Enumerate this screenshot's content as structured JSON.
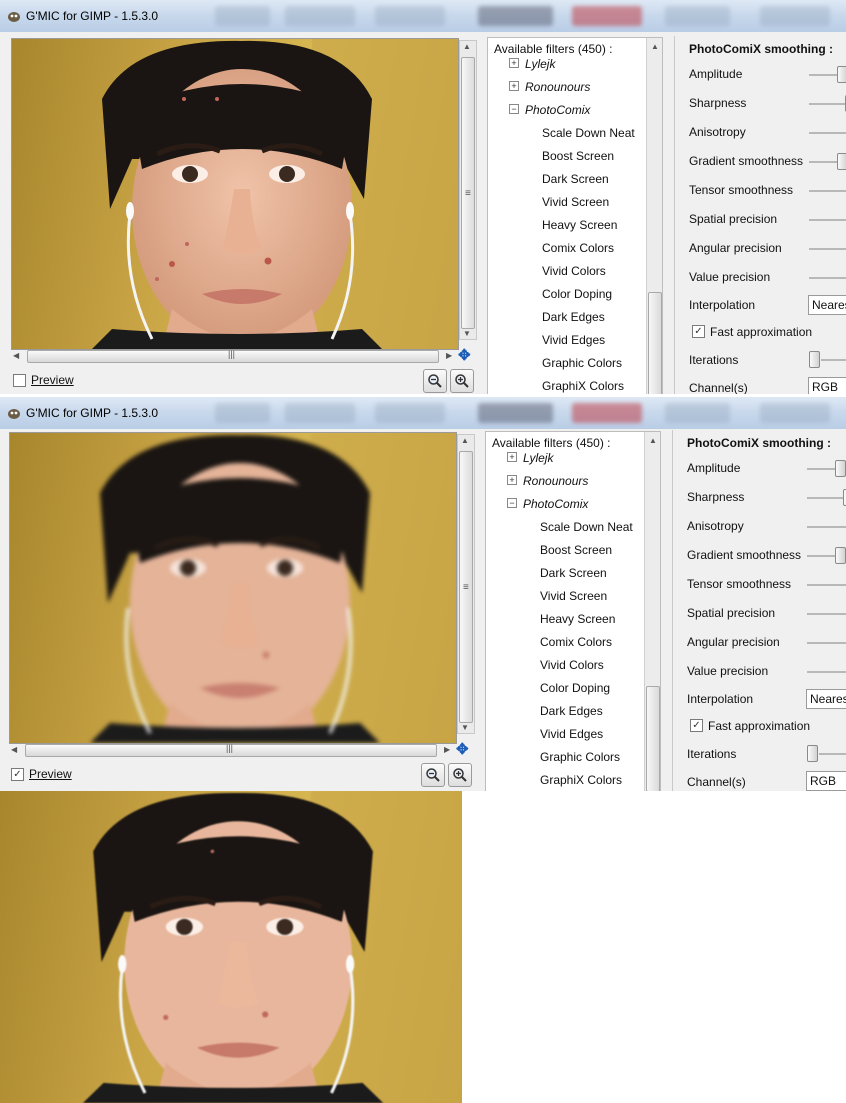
{
  "windows": [
    {
      "id": "before",
      "title": "G'MIC for GIMP - 1.5.3.0",
      "preview_label": "Preview",
      "preview_checked": false,
      "filters": {
        "header": "Available filters (450) :",
        "categories": [
          "Lylejk",
          "Ronounours",
          "PhotoComix"
        ],
        "items": [
          "Scale Down Neat",
          "Boost Screen",
          "Dark Screen",
          "Vivid Screen",
          "Heavy Screen",
          "Comix Colors",
          "Vivid Colors",
          "Color Doping",
          "Dark Edges",
          "Vivid Edges",
          "Graphic Colors",
          "GraphiX Colors"
        ]
      },
      "params": {
        "title": "PhotoComiX smoothing :",
        "labels": [
          "Amplitude",
          "Sharpness",
          "Anisotropy",
          "Gradient smoothness",
          "Tensor smoothness",
          "Spatial precision",
          "Angular precision",
          "Value precision",
          "Interpolation",
          "Fast approximation",
          "Iterations",
          "Channel(s)"
        ],
        "interpolation_value": "Nearest",
        "channel_value": "RGB",
        "fast_approximation_checked": true
      }
    },
    {
      "id": "after",
      "title": "G'MIC for GIMP - 1.5.3.0",
      "preview_label": "Preview",
      "preview_checked": true,
      "filters": {
        "header": "Available filters (450) :",
        "categories": [
          "Lylejk",
          "Ronounours",
          "PhotoComix"
        ],
        "items": [
          "Scale Down Neat",
          "Boost Screen",
          "Dark Screen",
          "Vivid Screen",
          "Heavy Screen",
          "Comix Colors",
          "Vivid Colors",
          "Color Doping",
          "Dark Edges",
          "Vivid Edges",
          "Graphic Colors",
          "GraphiX Colors"
        ]
      },
      "params": {
        "title": "PhotoComiX smoothing :",
        "labels": [
          "Amplitude",
          "Sharpness",
          "Anisotropy",
          "Gradient smoothness",
          "Tensor smoothness",
          "Spatial precision",
          "Angular precision",
          "Value precision",
          "Interpolation",
          "Fast approximation",
          "Iterations",
          "Channel(s)"
        ],
        "interpolation_value": "Nearest",
        "channel_value": "RGB",
        "fast_approximation_checked": true
      }
    }
  ],
  "colors": {
    "titlebar": "#c9d9ec",
    "photo_background": "#c8a445",
    "skin": "#e6b49a",
    "hair": "#1a1512",
    "move_icon": "#1c5db8"
  }
}
